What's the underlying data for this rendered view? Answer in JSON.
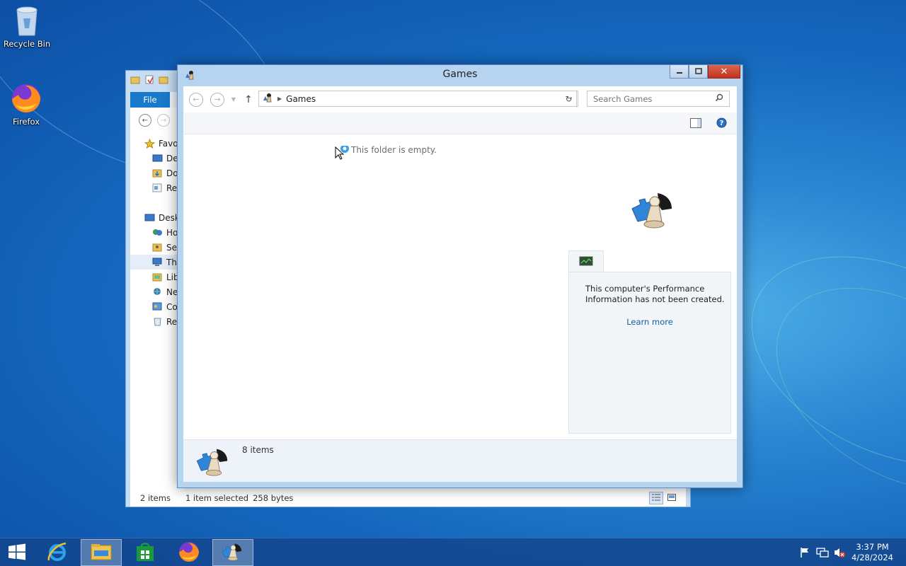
{
  "desktop": {
    "icons": [
      {
        "label": "Recycle Bin",
        "icon": "recycle-bin-icon"
      },
      {
        "label": "Firefox",
        "icon": "firefox-icon"
      }
    ]
  },
  "back_window": {
    "ribbon_file_tab": "File",
    "tree": [
      {
        "label": "Favo",
        "icon": "star-icon"
      },
      {
        "label": "De",
        "icon": "desktop-icon"
      },
      {
        "label": "Do",
        "icon": "downloads-icon"
      },
      {
        "label": "Re",
        "icon": "recent-places-icon"
      },
      {
        "label": "Desk",
        "icon": "desktop-icon"
      },
      {
        "label": "Ho",
        "icon": "homegroup-icon"
      },
      {
        "label": "Sel",
        "icon": "user-folder-icon"
      },
      {
        "label": "Th",
        "icon": "this-pc-icon"
      },
      {
        "label": "Lib",
        "icon": "libraries-icon"
      },
      {
        "label": "Ne",
        "icon": "network-icon"
      },
      {
        "label": "Co",
        "icon": "control-panel-icon"
      },
      {
        "label": "Re",
        "icon": "recycle-bin-icon"
      }
    ],
    "status": {
      "items": "2 items",
      "selected": "1 item selected",
      "size": "258 bytes"
    }
  },
  "games_window": {
    "title": "Games",
    "breadcrumb": "Games",
    "search_placeholder": "Search Games",
    "empty_message": "This folder is empty.",
    "performance": {
      "message": "This computer's Performance Information has not been created.",
      "link": "Learn more"
    },
    "details": {
      "count": "8 items"
    }
  },
  "taskbar": {
    "buttons": [
      "start-icon",
      "internet-explorer-icon",
      "file-explorer-icon",
      "store-icon",
      "firefox-icon",
      "games-icon"
    ],
    "time": "3:37 PM",
    "date": "4/28/2024"
  },
  "colors": {
    "accent": "#1979ca",
    "link": "#0c5fa8",
    "close": "#c2321b"
  }
}
